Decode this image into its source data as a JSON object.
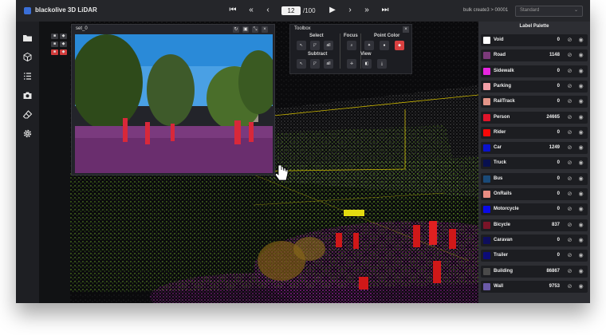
{
  "app": {
    "title": "blackolive 3D LiDAR",
    "logo_color": "#3a6fd8"
  },
  "navigation": {
    "first_icon": "⏮",
    "prev_fast_icon": "«",
    "prev_icon": "‹",
    "current_page": "12",
    "total_pages": "/100",
    "next_icon": "›",
    "play_icon": "▶",
    "next_fast_icon": "»",
    "last_icon": "⏭"
  },
  "header": {
    "bulk_label": "bulk create3 > 00001",
    "mode_value": "Standard",
    "mode_caret": "⌄"
  },
  "sidebar": {
    "items": [
      {
        "icon": "folder-icon"
      },
      {
        "icon": "cube-icon"
      },
      {
        "icon": "list-icon"
      },
      {
        "icon": "camera-icon"
      },
      {
        "icon": "eraser-icon"
      },
      {
        "icon": "gear-icon"
      }
    ]
  },
  "camera_panel": {
    "title": "set_0",
    "buttons": [
      "↻",
      "▣",
      "⤡",
      "×"
    ]
  },
  "toolbox": {
    "title": "Toolbox",
    "close": "×",
    "sections": {
      "select": "Select",
      "focus": "Focus",
      "point_color": "Point Color",
      "subtract": "Subtract",
      "view": "View"
    },
    "buttons": {
      "all": "all"
    }
  },
  "palette": {
    "title": "Label Palette",
    "rows": [
      {
        "name": "Void",
        "count": "0",
        "color": "#ffffff"
      },
      {
        "name": "Road",
        "count": "1148",
        "color": "#7b3a7a"
      },
      {
        "name": "Sidewalk",
        "count": "0",
        "color": "#e826e0"
      },
      {
        "name": "Parking",
        "count": "0",
        "color": "#f2a0a8"
      },
      {
        "name": "RailTrack",
        "count": "0",
        "color": "#e39488"
      },
      {
        "name": "Person",
        "count": "24665",
        "color": "#e0142a"
      },
      {
        "name": "Rider",
        "count": "0",
        "color": "#f80808"
      },
      {
        "name": "Car",
        "count": "1249",
        "color": "#0a12cc"
      },
      {
        "name": "Truck",
        "count": "0",
        "color": "#08104f"
      },
      {
        "name": "Bus",
        "count": "0",
        "color": "#1a4a78"
      },
      {
        "name": "OnRails",
        "count": "0",
        "color": "#e88c82"
      },
      {
        "name": "Motorcycle",
        "count": "0",
        "color": "#0a0ae8"
      },
      {
        "name": "Bicycle",
        "count": "837",
        "color": "#7a1428"
      },
      {
        "name": "Caravan",
        "count": "0",
        "color": "#0e0e5c"
      },
      {
        "name": "Trailer",
        "count": "0",
        "color": "#0c0c78"
      },
      {
        "name": "Building",
        "count": "86867",
        "color": "#4a4a4a"
      },
      {
        "name": "Wall",
        "count": "9753",
        "color": "#6a5aa8"
      }
    ],
    "hide_icon": "⊘",
    "visibility_icon": "◉"
  }
}
